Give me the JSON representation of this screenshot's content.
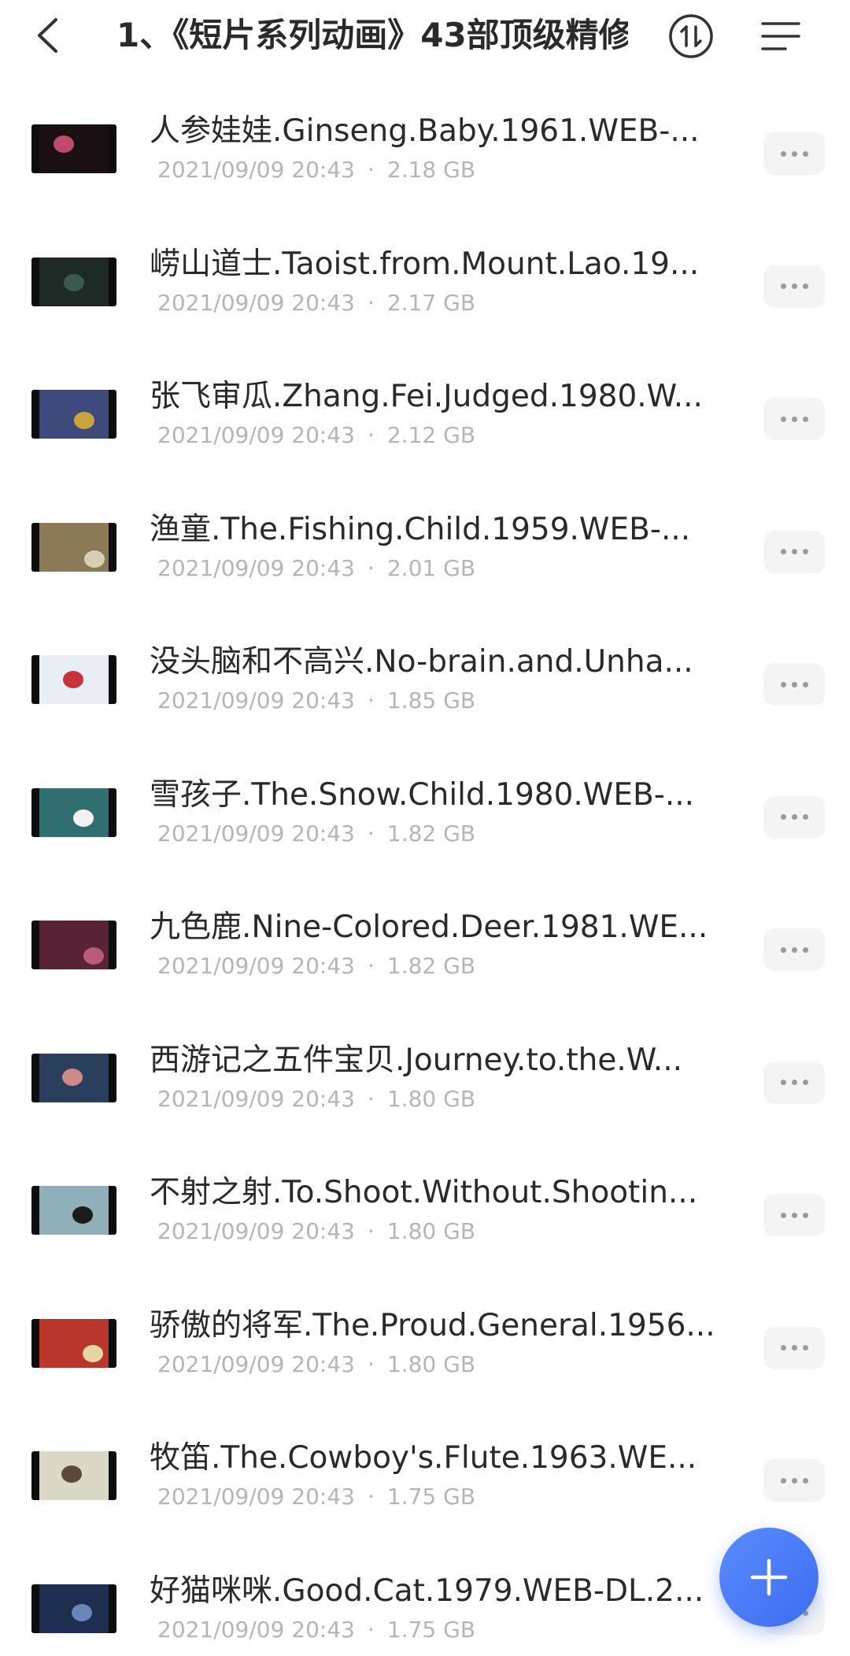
{
  "header": {
    "title": "1、《短片系列动画》43部顶级精修版",
    "back_icon": "chevron-left-icon",
    "sort_icon": "sort-icon",
    "menu_icon": "menu-icon"
  },
  "files": [
    {
      "name": "人参娃娃.Ginseng.Baby.1961.WEB-...",
      "date": "2021/09/09 20:43",
      "size": "2.18 GB",
      "thumb_bg": "#1a0f12",
      "thumb_spot": "#c04a6a"
    },
    {
      "name": "崂山道士.Taoist.from.Mount.Lao.19...",
      "date": "2021/09/09 20:43",
      "size": "2.17 GB",
      "thumb_bg": "#1e2a25",
      "thumb_spot": "#3b5a4e"
    },
    {
      "name": "张飞审瓜.Zhang.Fei.Judged.1980.W...",
      "date": "2021/09/09 20:43",
      "size": "2.12 GB",
      "thumb_bg": "#3e4a7c",
      "thumb_spot": "#c9a33c"
    },
    {
      "name": "渔童.The.Fishing.Child.1959.WEB-...",
      "date": "2021/09/09 20:43",
      "size": "2.01 GB",
      "thumb_bg": "#8a7a58",
      "thumb_spot": "#d8ceb2"
    },
    {
      "name": "没头脑和不高兴.No-brain.and.Unha...",
      "date": "2021/09/09 20:43",
      "size": "1.85 GB",
      "thumb_bg": "#e8eef4",
      "thumb_spot": "#c8323a"
    },
    {
      "name": "雪孩子.The.Snow.Child.1980.WEB-...",
      "date": "2021/09/09 20:43",
      "size": "1.82 GB",
      "thumb_bg": "#2f6f70",
      "thumb_spot": "#f2f2f2"
    },
    {
      "name": "九色鹿.Nine-Colored.Deer.1981.WE...",
      "date": "2021/09/09 20:43",
      "size": "1.82 GB",
      "thumb_bg": "#5a2236",
      "thumb_spot": "#b85a7a"
    },
    {
      "name": "西游记之五件宝贝.Journey.to.the.W...",
      "date": "2021/09/09 20:43",
      "size": "1.80 GB",
      "thumb_bg": "#2a3e5e",
      "thumb_spot": "#d08a86"
    },
    {
      "name": "不射之射.To.Shoot.Without.Shootin...",
      "date": "2021/09/09 20:43",
      "size": "1.80 GB",
      "thumb_bg": "#8fb0b8",
      "thumb_spot": "#1b1b1b"
    },
    {
      "name": "骄傲的将军.The.Proud.General.1956...",
      "date": "2021/09/09 20:43",
      "size": "1.80 GB",
      "thumb_bg": "#b8362c",
      "thumb_spot": "#e8d6a2"
    },
    {
      "name": "牧笛.The.Cowboy's.Flute.1963.WE...",
      "date": "2021/09/09 20:43",
      "size": "1.75 GB",
      "thumb_bg": "#dcd8c8",
      "thumb_spot": "#5a4a3a"
    },
    {
      "name": "好猫咪咪.Good.Cat.1979.WEB-DL.2...",
      "date": "2021/09/09 20:43",
      "size": "1.75 GB",
      "thumb_bg": "#1e2e50",
      "thumb_spot": "#6a86b8"
    }
  ],
  "more_icon": "more-horizontal-icon",
  "fab": {
    "icon": "plus-icon",
    "color": "#4a7cf6"
  }
}
